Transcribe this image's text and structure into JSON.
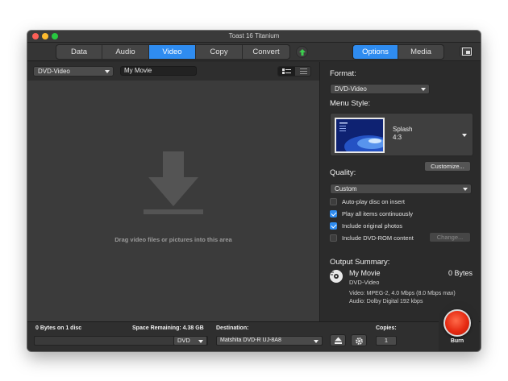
{
  "window": {
    "title": "Toast 16 Titanium"
  },
  "toolbar": {
    "tabs": [
      {
        "label": "Data",
        "active": false
      },
      {
        "label": "Audio",
        "active": false
      },
      {
        "label": "Video",
        "active": true
      },
      {
        "label": "Copy",
        "active": false
      },
      {
        "label": "Convert",
        "active": false
      }
    ],
    "right_tabs": [
      {
        "label": "Options",
        "active": true
      },
      {
        "label": "Media",
        "active": false
      }
    ],
    "upload_icon": "arrow-up-circle-icon",
    "pip_icon": "picture-in-picture-icon",
    "accent_color": "#2f8cf0"
  },
  "left": {
    "format_select": "DVD-Video",
    "title_input": "My Movie",
    "drop_hint": "Drag video files or pictures into this area"
  },
  "options": {
    "format_label": "Format:",
    "format_value": "DVD-Video",
    "menu_style_label": "Menu Style:",
    "menu_style_name": "Splash",
    "menu_style_ratio": "4:3",
    "customize_label": "Customize...",
    "quality_label": "Quality:",
    "quality_value": "Custom",
    "checkboxes": [
      {
        "label": "Auto-play disc on insert",
        "checked": false
      },
      {
        "label": "Play all items continuously",
        "checked": true
      },
      {
        "label": "Include original photos",
        "checked": true
      },
      {
        "label": "Include DVD-ROM content",
        "checked": false
      }
    ],
    "change_label": "Change...",
    "summary_label": "Output Summary:",
    "summary": {
      "title": "My Movie",
      "bytes": "0 Bytes",
      "format": "DVD-Video",
      "video": "Video: MPEG-2, 4.0 Mbps (8.0 Mbps max)",
      "audio": "Audio: Dolby Digital 192 kbps"
    }
  },
  "bottom": {
    "usage": "0 Bytes on 1 disc",
    "space_remaining": "Space Remaining: 4.38 GB",
    "media_type": "DVD",
    "destination_label": "Destination:",
    "destination_value": "Matshita DVD-R   UJ-8A8",
    "copies_label": "Copies:",
    "copies_value": "1",
    "burn_label": "Burn"
  }
}
